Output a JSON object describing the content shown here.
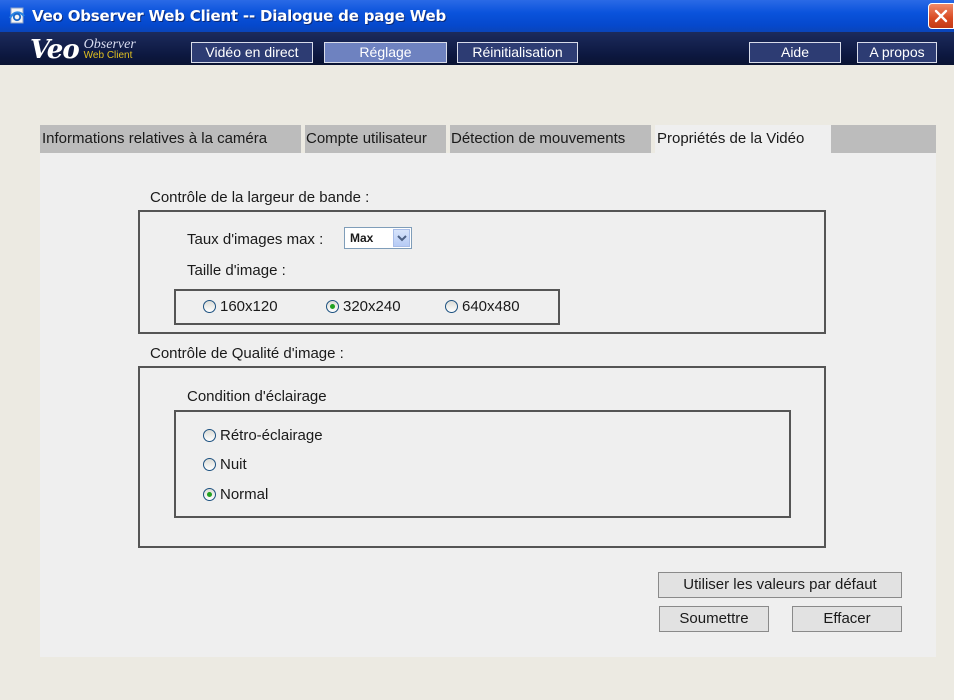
{
  "window": {
    "title": "Veo Observer Web Client -- Dialogue de page Web",
    "icons": {
      "app": "ie-page-icon",
      "close": "close-icon"
    }
  },
  "logo": {
    "brand": "Veo",
    "product": "Observer",
    "sub": "Web Client"
  },
  "nav": {
    "live_video": "Vidéo en direct",
    "settings": "Réglage",
    "reset": "Réinitialisation",
    "help": "Aide",
    "about": "A propos"
  },
  "tabs": {
    "camera_info": "Informations relatives à la caméra",
    "user_account": "Compte utilisateur",
    "motion_detection": "Détection de mouvements",
    "video_properties": "Propriétés de la Vidéo",
    "active": "video_properties"
  },
  "bandwidth": {
    "label": "Contrôle de la largeur de bande :",
    "max_fps_label": "Taux d'images max :",
    "max_fps_value": "Max",
    "image_size_label": "Taille d'image :",
    "sizes": [
      "160x120",
      "320x240",
      "640x480"
    ],
    "selected_size": "320x240"
  },
  "quality": {
    "label": "Contrôle de Qualité d'image :",
    "lighting_label": "Condition d'éclairage",
    "options": [
      "Rétro-éclairage",
      "Nuit",
      "Normal"
    ],
    "selected_option": "Normal"
  },
  "actions": {
    "defaults": "Utiliser les valeurs par défaut",
    "submit": "Soumettre",
    "clear": "Effacer"
  },
  "colors": {
    "titlebar": "#0548cc",
    "header": "#0d1840",
    "nav_active": "#6e82c0",
    "tab_bar": "#bcbcbc",
    "panel": "#efefef",
    "radio_dot": "#21a121"
  }
}
